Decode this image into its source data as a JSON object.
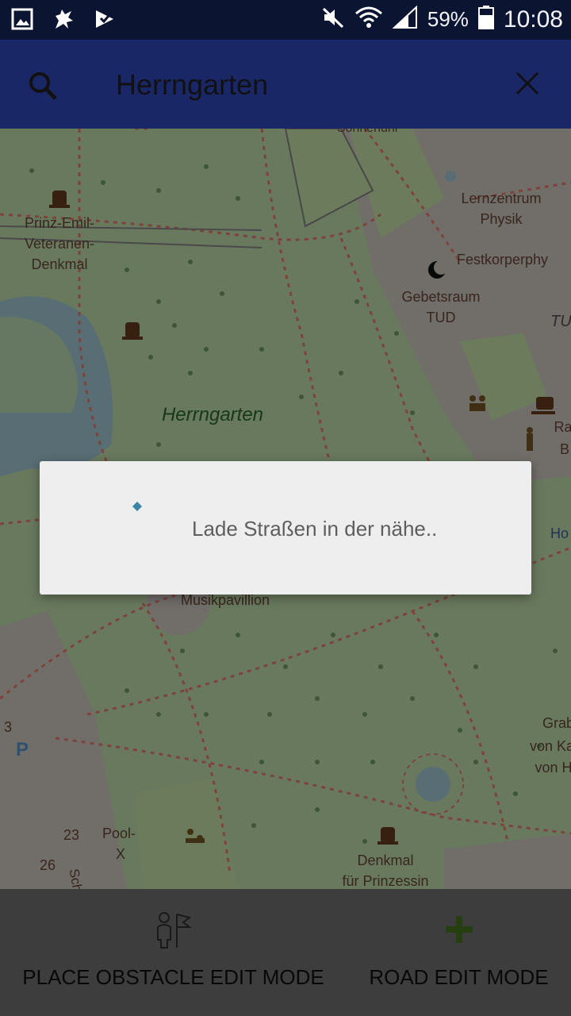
{
  "status_bar": {
    "battery": "59%",
    "time": "10:08",
    "icons": [
      "gallery-icon",
      "griffin-app-icon",
      "checklist-icon",
      "mute-icon",
      "wifi-icon",
      "signal-icon",
      "battery-icon"
    ]
  },
  "app_bar": {
    "search_query": "Herrngarten",
    "icons": [
      "search-icon",
      "close-icon"
    ],
    "color": "#1a2767"
  },
  "map": {
    "labels": {
      "prinz_emil_1": "Prinz-Emil-",
      "prinz_emil_2": "Veteranen-",
      "prinz_emil_3": "Denkmal",
      "lernzentrum_1": "Lernzentrum",
      "lernzentrum_2": "Physik",
      "festkorper": "Festkorperphy",
      "gebetsraum_1": "Gebetsraum",
      "gebetsraum_2": "TUD",
      "tu": "TU De",
      "herrngarten": "Herrngarten",
      "ra": "Ra",
      "b": "B",
      "ho": "Ho",
      "musikpavillion": "Musikpavillion",
      "grab_1": "Grab",
      "grab_2": "von Ka",
      "grab_3": "von H",
      "pool_1": "Pool-",
      "pool_2": "X",
      "num_3": "3",
      "num_23": "23",
      "num_26": "26",
      "sch": "Sch",
      "denkmal_1": "Denkmal",
      "denkmal_2": "für Prinzessin",
      "sonnenuhr": "Sonnenuhr",
      "parking": "P"
    },
    "colors": {
      "park": "#c9e9b4",
      "building": "#d8d1c9",
      "path": "#f08173",
      "water": "#aad3df"
    }
  },
  "dialog": {
    "message": "Lade Straßen in der nähe..",
    "spinner_color": "#1e88a8"
  },
  "bottom_bar": {
    "place_obstacle_label": "PLACE OBSTACLE EDIT MODE",
    "road_edit_label": "ROAD EDIT MODE",
    "road_plus_color": "#5aa227"
  }
}
